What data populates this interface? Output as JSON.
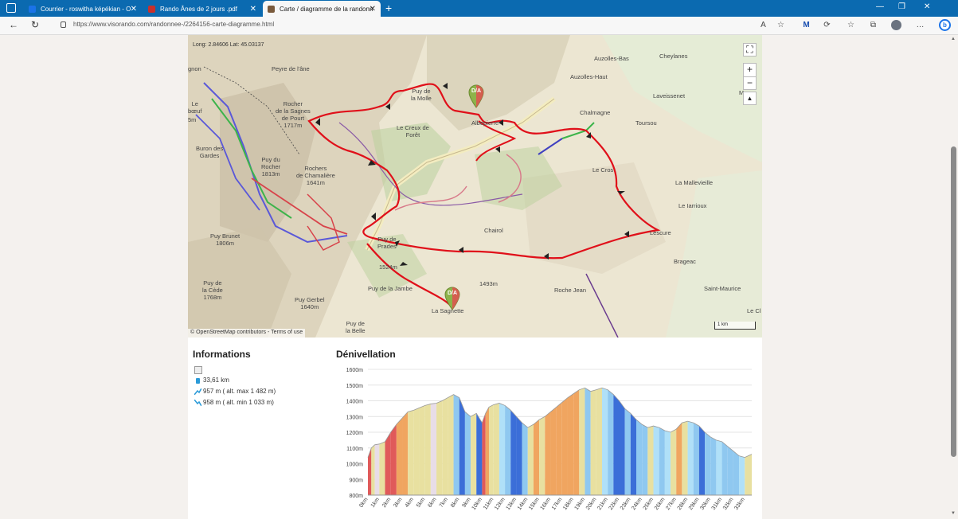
{
  "browser": {
    "tabs": [
      {
        "label": "Courrier - roswitha képékian - O",
        "icon_color": "#0a5cad"
      },
      {
        "label": "Rando Ânes de 2 jours .pdf",
        "icon_color": "#c9302c"
      },
      {
        "label": "Carte / diagramme de la randonn",
        "icon_color": "#7a5a3c"
      }
    ],
    "url": "https://www.visorando.com/randonnee-/2264156-carte-diagramme.html"
  },
  "map": {
    "coords": "Long: 2.84606 Lat: 45.03137",
    "attribution": "© OpenStreetMap contributors - Terms of use",
    "scale": "1 km",
    "zoom_in": "+",
    "zoom_out": "−",
    "reset": "▲",
    "fullscreen": "⛶",
    "pin_label": "D/A",
    "labels": [
      {
        "text": "Peyre de\nl'âne"
      },
      {
        "text": "Rocher\nde la Sagnes\nde Pourt\n1717m"
      },
      {
        "text": "Puy de\nla Molle"
      },
      {
        "text": "Le Creux de\nForêt"
      },
      {
        "text": "Albepierre"
      },
      {
        "text": "Buron des\nGardes"
      },
      {
        "text": "Puy du\nRocher\n1813m"
      },
      {
        "text": "Rochers\nde Chamalière\n1641m"
      },
      {
        "text": "Puy Brunet\n1806m"
      },
      {
        "text": "Puy de\nPrades"
      },
      {
        "text": "1524m"
      },
      {
        "text": "Puy de la Jambe"
      },
      {
        "text": "Puy de\nla Cède\n1768m"
      },
      {
        "text": "Puy Gerbel\n1640m"
      },
      {
        "text": "Puy de\nla Belle"
      },
      {
        "text": "La Sagnette"
      },
      {
        "text": "Chairol"
      },
      {
        "text": "1493m"
      },
      {
        "text": "Roche Jean"
      },
      {
        "text": "Auzolles-Bas"
      },
      {
        "text": "Cheylanes"
      },
      {
        "text": "Auzolles-Haut"
      },
      {
        "text": "Laveissenet"
      },
      {
        "text": "Chalmagne"
      },
      {
        "text": "Toursou"
      },
      {
        "text": "Le Cros"
      },
      {
        "text": "La Mallevieille"
      },
      {
        "text": "Le Iarrioux"
      },
      {
        "text": "Lescure"
      },
      {
        "text": "Brageac"
      },
      {
        "text": "Saint-Maurice"
      },
      {
        "text": "Le Cl"
      },
      {
        "text": "M"
      },
      {
        "text": "Le\nbœuf"
      },
      {
        "text": "5m"
      },
      {
        "text": "gnon"
      }
    ]
  },
  "info": {
    "title": "Informations",
    "distance": "33,61 km",
    "ascent": "957 m ( alt. max 1 482 m)",
    "descent": "958 m ( alt. min 1 033 m)"
  },
  "chart_data": {
    "type": "area",
    "title": "Dénivellation",
    "y_ticks": [
      "800m",
      "900m",
      "1000m",
      "1100m",
      "1200m",
      "1300m",
      "1400m",
      "1500m",
      "1600m"
    ],
    "ylim": [
      800,
      1600
    ],
    "x_ticks": [
      "0km",
      "1km",
      "2km",
      "3km",
      "4km",
      "5km",
      "6km",
      "7km",
      "8km",
      "9km",
      "10km",
      "11km",
      "12km",
      "13km",
      "14km",
      "15km",
      "16km",
      "17km",
      "18km",
      "19km",
      "20km",
      "21km",
      "22km",
      "23km",
      "24km",
      "25km",
      "26km",
      "27km",
      "28km",
      "29km",
      "30km",
      "31km",
      "32km",
      "33km"
    ],
    "xlim": [
      0,
      33.61
    ],
    "series": [
      {
        "x": [
          0,
          0.3,
          0.6,
          1.0,
          1.5,
          2.0,
          2.5,
          3.0,
          3.5,
          4.0,
          4.5,
          5.0,
          5.5,
          6.0,
          6.5,
          7.0,
          7.5,
          8.0,
          8.5,
          9.0,
          9.5,
          10.0,
          10.3,
          10.6,
          11.0,
          11.5,
          12.0,
          12.5,
          13.0,
          13.5,
          14.0,
          14.5,
          15.0,
          15.5,
          16.0,
          16.5,
          17.0,
          17.5,
          18.0,
          18.5,
          19.0,
          19.5,
          20.0,
          20.5,
          21.0,
          21.5,
          22.0,
          22.5,
          23.0,
          23.5,
          24.0,
          24.5,
          25.0,
          25.5,
          26.0,
          26.5,
          27.0,
          27.5,
          28.0,
          28.5,
          29.0,
          29.5,
          30.0,
          30.5,
          31.0,
          31.5,
          32.0,
          32.5,
          33.0,
          33.61
        ],
        "y": [
          1040,
          1100,
          1120,
          1125,
          1140,
          1200,
          1250,
          1290,
          1330,
          1340,
          1355,
          1370,
          1380,
          1385,
          1400,
          1420,
          1440,
          1420,
          1330,
          1300,
          1320,
          1260,
          1320,
          1360,
          1375,
          1385,
          1370,
          1340,
          1300,
          1260,
          1230,
          1250,
          1280,
          1300,
          1330,
          1360,
          1390,
          1420,
          1445,
          1470,
          1482,
          1460,
          1470,
          1482,
          1470,
          1440,
          1400,
          1350,
          1320,
          1280,
          1250,
          1230,
          1240,
          1230,
          1210,
          1200,
          1220,
          1260,
          1270,
          1260,
          1240,
          1200,
          1170,
          1150,
          1140,
          1110,
          1080,
          1050,
          1040,
          1060
        ]
      }
    ],
    "slope_colors": [
      "#e8c98a",
      "#f0a560",
      "#e05a5a",
      "#e8dde8",
      "#e8e0a0",
      "#3b6ed8",
      "#8fc8f0",
      "#b0e0f8"
    ]
  }
}
